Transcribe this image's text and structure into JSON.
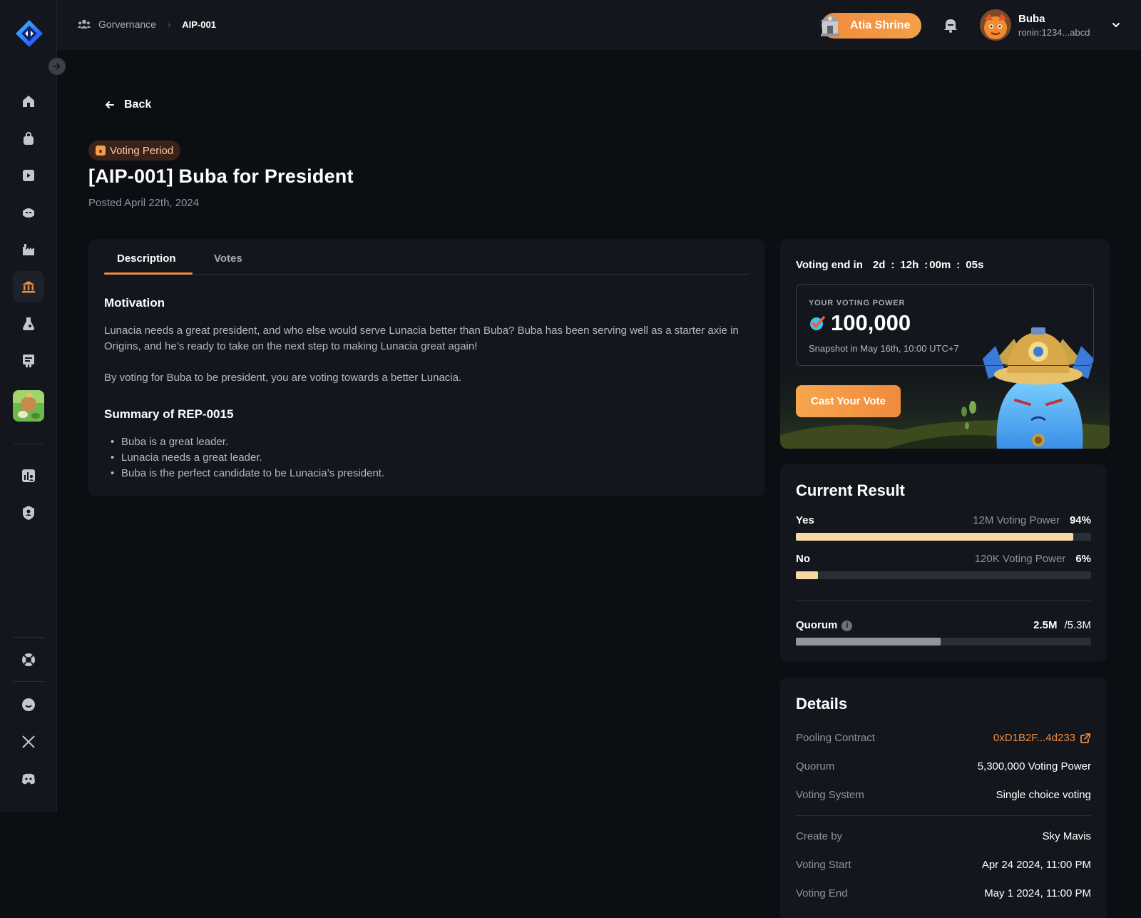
{
  "topbar": {
    "breadcrumb_root": "Gorvernance",
    "breadcrumb_current": "AIP-001",
    "shrine_label": "Atia Shrine",
    "user_name": "Buba",
    "user_address": "ronin:1234...abcd"
  },
  "sidebar": {
    "items": [
      "home-icon",
      "bag-icon",
      "video-icon",
      "axie-icon",
      "factory-icon",
      "governance-icon",
      "flask-icon",
      "news-icon",
      "game-thumbnail",
      "stats-icon",
      "shield-icon",
      "support-icon",
      "chat-icon",
      "x-icon",
      "discord-icon"
    ],
    "active": "governance-icon"
  },
  "page": {
    "back_label": "Back",
    "badge_label": "Voting Period",
    "title": "[AIP-001] Buba for President",
    "posted": "Posted April 22th, 2024"
  },
  "description": {
    "tabs": [
      "Description",
      "Votes"
    ],
    "active_tab": "Description",
    "motivation_heading": "Motivation",
    "motivation_p1": "Lunacia needs a great president, and who else would serve Lunacia better than Buba? Buba has been serving well as a starter axie in Origins, and he’s ready to take on the next step to making Lunacia great again!",
    "motivation_p2": "By voting for Buba to be president, you are voting towards a better Lunacia.",
    "summary_heading": "Summary of REP-0015",
    "summary_items": [
      "Buba is a great leader.",
      "Lunacia needs a great leader.",
      "Buba is the perfect candidate to be Lunacia’s president."
    ]
  },
  "voting": {
    "end_label": "Voting end in",
    "days": "2d",
    "hours": "12h",
    "minutes": "00m",
    "seconds": "05s",
    "power_label": "YOUR VOTING POWER",
    "power_value": "100,000",
    "snapshot": "Snapshot in May 16th, 10:00 UTC+7",
    "cast_label": "Cast Your Vote"
  },
  "result": {
    "title": "Current Result",
    "yes_label": "Yes",
    "yes_power": "12M Voting Power",
    "yes_pct": "94%",
    "yes_fill": 0.94,
    "no_label": "No",
    "no_power": "120K Voting Power",
    "no_pct": "6%",
    "no_fill": 0.075,
    "quorum_label": "Quorum",
    "quorum_current": "2.5M",
    "quorum_total": "/5.3M",
    "quorum_fill": 0.49
  },
  "details": {
    "title": "Details",
    "rows": [
      {
        "label": "Pooling Contract",
        "value": "0xD1B2F...4d233"
      },
      {
        "label": "Quorum",
        "value": "5,300,000 Voting Power"
      },
      {
        "label": "Voting System",
        "value": "Single choice voting"
      },
      {
        "label": "Create by",
        "value": "Sky Mavis"
      },
      {
        "label": "Voting Start",
        "value": "Apr 24 2024, 11:00 PM"
      },
      {
        "label": "Voting End",
        "value": "May 1 2024, 11:00 PM"
      }
    ]
  },
  "colors": {
    "accent": "#f08a3c",
    "bar_yes": "#f7d9a3",
    "bar_quorum": "#8f949d",
    "background": "#0b0e13",
    "card": "#13161c"
  }
}
